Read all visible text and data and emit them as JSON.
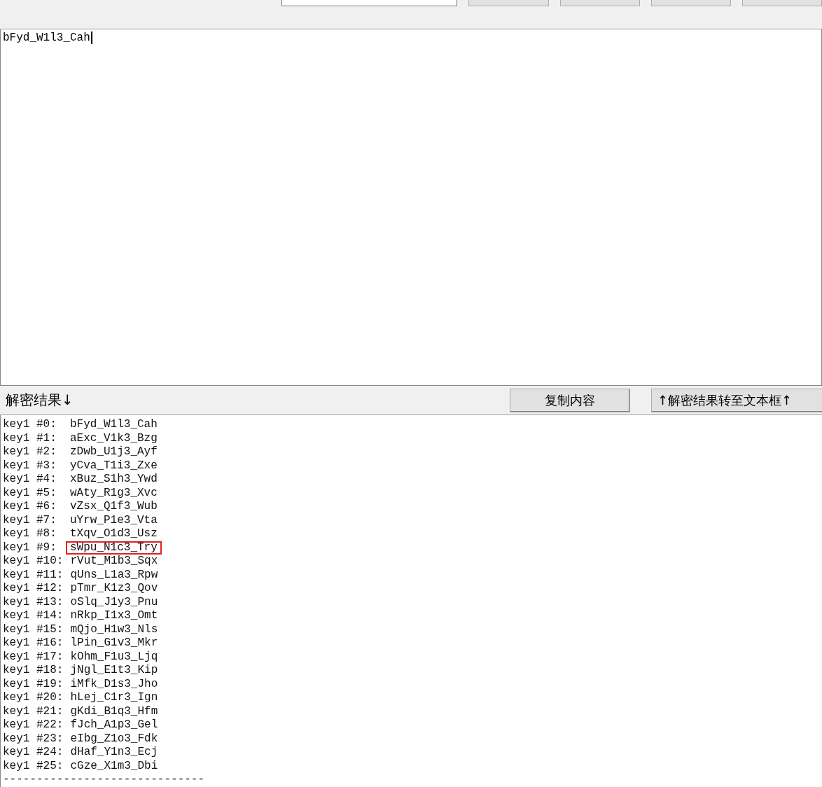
{
  "input_text": "bFyd_W1l3_Cah",
  "result_bar": {
    "label": "解密结果↓",
    "buttons": [
      "复制内容",
      "↑解密结果转至文本框↑"
    ]
  },
  "results": [
    {
      "key": "key1 #0:",
      "value": "bFyd_W1l3_Cah",
      "highlighted": false
    },
    {
      "key": "key1 #1:",
      "value": "aExc_V1k3_Bzg",
      "highlighted": false
    },
    {
      "key": "key1 #2:",
      "value": "zDwb_U1j3_Ayf",
      "highlighted": false
    },
    {
      "key": "key1 #3:",
      "value": "yCva_T1i3_Zxe",
      "highlighted": false
    },
    {
      "key": "key1 #4:",
      "value": "xBuz_S1h3_Ywd",
      "highlighted": false
    },
    {
      "key": "key1 #5:",
      "value": "wAty_R1g3_Xvc",
      "highlighted": false
    },
    {
      "key": "key1 #6:",
      "value": "vZsx_Q1f3_Wub",
      "highlighted": false
    },
    {
      "key": "key1 #7:",
      "value": "uYrw_P1e3_Vta",
      "highlighted": false
    },
    {
      "key": "key1 #8:",
      "value": "tXqv_O1d3_Usz",
      "highlighted": false
    },
    {
      "key": "key1 #9:",
      "value": "sWpu_N1c3_Try",
      "highlighted": true
    },
    {
      "key": "key1 #10:",
      "value": "rVut_M1b3_Sqx",
      "highlighted": false
    },
    {
      "key": "key1 #11:",
      "value": "qUns_L1a3_Rpw",
      "highlighted": false
    },
    {
      "key": "key1 #12:",
      "value": "pTmr_K1z3_Qov",
      "highlighted": false
    },
    {
      "key": "key1 #13:",
      "value": "oSlq_J1y3_Pnu",
      "highlighted": false
    },
    {
      "key": "key1 #14:",
      "value": "nRkp_I1x3_Omt",
      "highlighted": false
    },
    {
      "key": "key1 #15:",
      "value": "mQjo_H1w3_Nls",
      "highlighted": false
    },
    {
      "key": "key1 #16:",
      "value": "lPin_G1v3_Mkr",
      "highlighted": false
    },
    {
      "key": "key1 #17:",
      "value": "kOhm_F1u3_Ljq",
      "highlighted": false
    },
    {
      "key": "key1 #18:",
      "value": "jNgl_E1t3_Kip",
      "highlighted": false
    },
    {
      "key": "key1 #19:",
      "value": "iMfk_D1s3_Jho",
      "highlighted": false
    },
    {
      "key": "key1 #20:",
      "value": "hLej_C1r3_Ign",
      "highlighted": false
    },
    {
      "key": "key1 #21:",
      "value": "gKdi_B1q3_Hfm",
      "highlighted": false
    },
    {
      "key": "key1 #22:",
      "value": "fJch_A1p3_Gel",
      "highlighted": false
    },
    {
      "key": "key1 #23:",
      "value": "eIbg_Z1o3_Fdk",
      "highlighted": false
    },
    {
      "key": "key1 #24:",
      "value": "dHaf_Y1n3_Ecj",
      "highlighted": false
    },
    {
      "key": "key1 #25:",
      "value": "cGze_X1m3_Dbi",
      "highlighted": false
    }
  ],
  "separator": "------------------------------"
}
